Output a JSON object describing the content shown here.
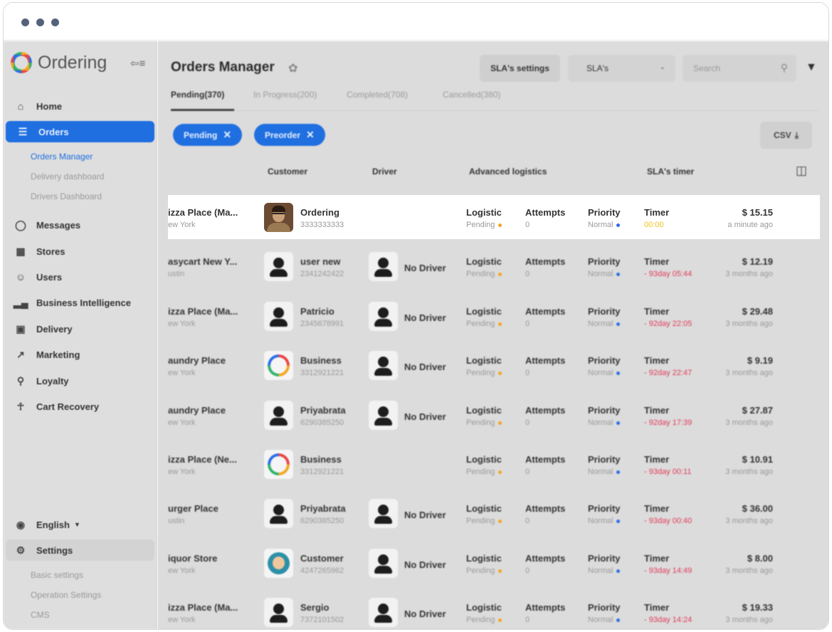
{
  "window": {
    "controls": [
      "dot",
      "dot",
      "dot"
    ]
  },
  "sidebar": {
    "brand": "Ordering",
    "items": [
      {
        "label": "Home",
        "icon": "home-icon"
      },
      {
        "label": "Orders",
        "icon": "list-icon"
      },
      {
        "label": "Messages",
        "icon": "chat-icon"
      },
      {
        "label": "Stores",
        "icon": "store-icon"
      },
      {
        "label": "Users",
        "icon": "users-icon"
      },
      {
        "label": "Business Intelligence",
        "icon": "bar-chart-icon"
      },
      {
        "label": "Delivery",
        "icon": "truck-icon"
      },
      {
        "label": "Marketing",
        "icon": "trend-icon"
      },
      {
        "label": "Loyalty",
        "icon": "award-icon"
      },
      {
        "label": "Cart Recovery",
        "icon": "cart-icon"
      }
    ],
    "orders_sub": [
      "Orders Manager",
      "Delivery dashboard",
      "Drivers Dashboard"
    ],
    "language": "English",
    "settings": "Settings",
    "settings_sub": [
      "Basic settings",
      "Operation Settings",
      "CMS"
    ]
  },
  "header": {
    "title": "Orders Manager",
    "sla_settings": "SLA's settings",
    "sla_select": "SLA's",
    "search_placeholder": "Search"
  },
  "tabs": [
    {
      "label": "Pending(370)"
    },
    {
      "label": "In Progress(200)"
    },
    {
      "label": "Completed(708)"
    },
    {
      "label": "Cancelled(380)"
    }
  ],
  "chips": [
    {
      "label": "Pending"
    },
    {
      "label": "Preorder"
    }
  ],
  "csv_label": "CSV",
  "columns": {
    "customer": "Customer",
    "driver": "Driver",
    "logistics": "Advanced logistics",
    "sla": "SLA's timer"
  },
  "field_labels": {
    "logistic": "Logistic",
    "attempts": "Attempts",
    "priority": "Priority",
    "timer": "Timer"
  },
  "rows": [
    {
      "business": "izza Place (Ma...",
      "city": "ew York",
      "customer": "Ordering",
      "phone": "3333333333",
      "driver": "",
      "logistic": "Pending",
      "attempts": "0",
      "priority": "Normal",
      "timer": "00:00",
      "price": "$ 15.15",
      "ago": "a minute ago",
      "avatar": "photo"
    },
    {
      "business": "asycart New Y...",
      "city": "ustin",
      "customer": "user new",
      "phone": "2341242422",
      "driver": "No Driver",
      "logistic": "Pending",
      "attempts": "0",
      "priority": "Normal",
      "timer": "- 93day 05:44",
      "price": "$ 12.19",
      "ago": "3 months ago",
      "avatar": "person"
    },
    {
      "business": "izza Place (Ma...",
      "city": "ew York",
      "customer": "Patricio",
      "phone": "2345678991",
      "driver": "No Driver",
      "logistic": "Pending",
      "attempts": "0",
      "priority": "Normal",
      "timer": "- 92day 22:05",
      "price": "$ 29.48",
      "ago": "3 months ago",
      "avatar": "person"
    },
    {
      "business": "aundry Place",
      "city": "ew York",
      "customer": "Business",
      "phone": "3312921221",
      "driver": "No Driver",
      "logistic": "Pending",
      "attempts": "0",
      "priority": "Normal",
      "timer": "- 92day 22:47",
      "price": "$ 9.19",
      "ago": "3 months ago",
      "avatar": "brand"
    },
    {
      "business": "aundry Place",
      "city": "ew York",
      "customer": "Priyabrata",
      "phone": "6290385250",
      "driver": "No Driver",
      "logistic": "Pending",
      "attempts": "0",
      "priority": "Normal",
      "timer": "- 92day 17:39",
      "price": "$ 27.87",
      "ago": "3 months ago",
      "avatar": "person"
    },
    {
      "business": "izza Place (Ne...",
      "city": "ew York",
      "customer": "Business",
      "phone": "3312921221",
      "driver": "",
      "logistic": "Pending",
      "attempts": "0",
      "priority": "Normal",
      "timer": "- 93day 00:11",
      "price": "$ 10.91",
      "ago": "3 months ago",
      "avatar": "brand"
    },
    {
      "business": "urger Place",
      "city": "ustin",
      "customer": "Priyabrata",
      "phone": "6290385250",
      "driver": "No Driver",
      "logistic": "Pending",
      "attempts": "0",
      "priority": "Normal",
      "timer": "- 93day 00:40",
      "price": "$ 36.00",
      "ago": "3 months ago",
      "avatar": "person"
    },
    {
      "business": "iquor Store",
      "city": "ew York",
      "customer": "Customer",
      "phone": "4247265962",
      "driver": "No Driver",
      "logistic": "Pending",
      "attempts": "0",
      "priority": "Normal",
      "timer": "- 93day 14:49",
      "price": "$ 8.00",
      "ago": "3 months ago",
      "avatar": "cartoon"
    },
    {
      "business": "izza Place (Ma...",
      "city": "ew York",
      "customer": "Sergio",
      "phone": "7372101502",
      "driver": "No Driver",
      "logistic": "Pending",
      "attempts": "0",
      "priority": "Normal",
      "timer": "- 93day 14:24",
      "price": "$ 19.33",
      "ago": "3 months ago",
      "avatar": "person"
    }
  ],
  "colors": {
    "accent": "#1f6fe0",
    "pending_dot": "#f4a623",
    "priority_dot": "#2b6de6",
    "timer_overdue": "#e23c5a",
    "timer_ok": "#f0c419"
  }
}
